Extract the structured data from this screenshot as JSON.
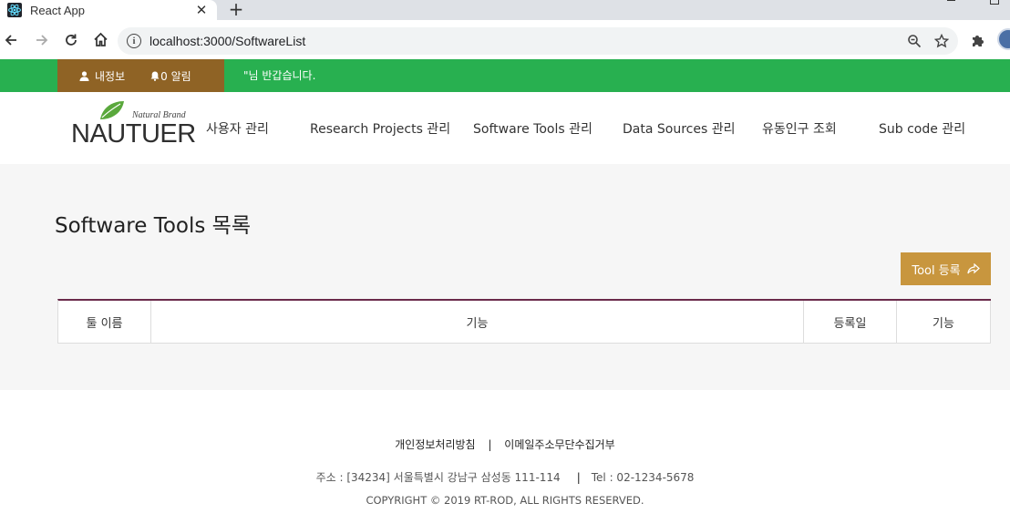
{
  "browser": {
    "tab_title": "React App",
    "tab_close": "✕",
    "new_tab": "+",
    "url": "localhost:3000/SoftwareList"
  },
  "topbar": {
    "my_info": "내정보",
    "alerts": "0 알림",
    "welcome": "\"님 반갑습니다."
  },
  "logo": {
    "brand": "Natural Brand",
    "name": "NAUTUER"
  },
  "nav": [
    "사용자 관리",
    "Research Projects 관리",
    "Software Tools 관리",
    "Data Sources 관리",
    "유동인구 조회",
    "Sub code 관리"
  ],
  "page": {
    "title": "Software Tools 목록",
    "register_button": "Tool 등록"
  },
  "table": {
    "columns": [
      "툴 이름",
      "기능",
      "등록일",
      "기능"
    ]
  },
  "footer": {
    "privacy": "개인정보처리방침",
    "separator": "|",
    "email_policy": "이메일주소무단수집거부",
    "address": "주소 : [34234] 서울특별시 강남구 삼성동 111-114",
    "tel": "Tel : 02-1234-5678",
    "copyright": "COPYRIGHT © 2019 RT-ROD, ALL RIGHTS RESERVED."
  },
  "colors": {
    "green_bar": "#28b050",
    "user_area": "#8f6325",
    "register_button": "#c8963e",
    "table_top_border": "#6a2a4a"
  }
}
